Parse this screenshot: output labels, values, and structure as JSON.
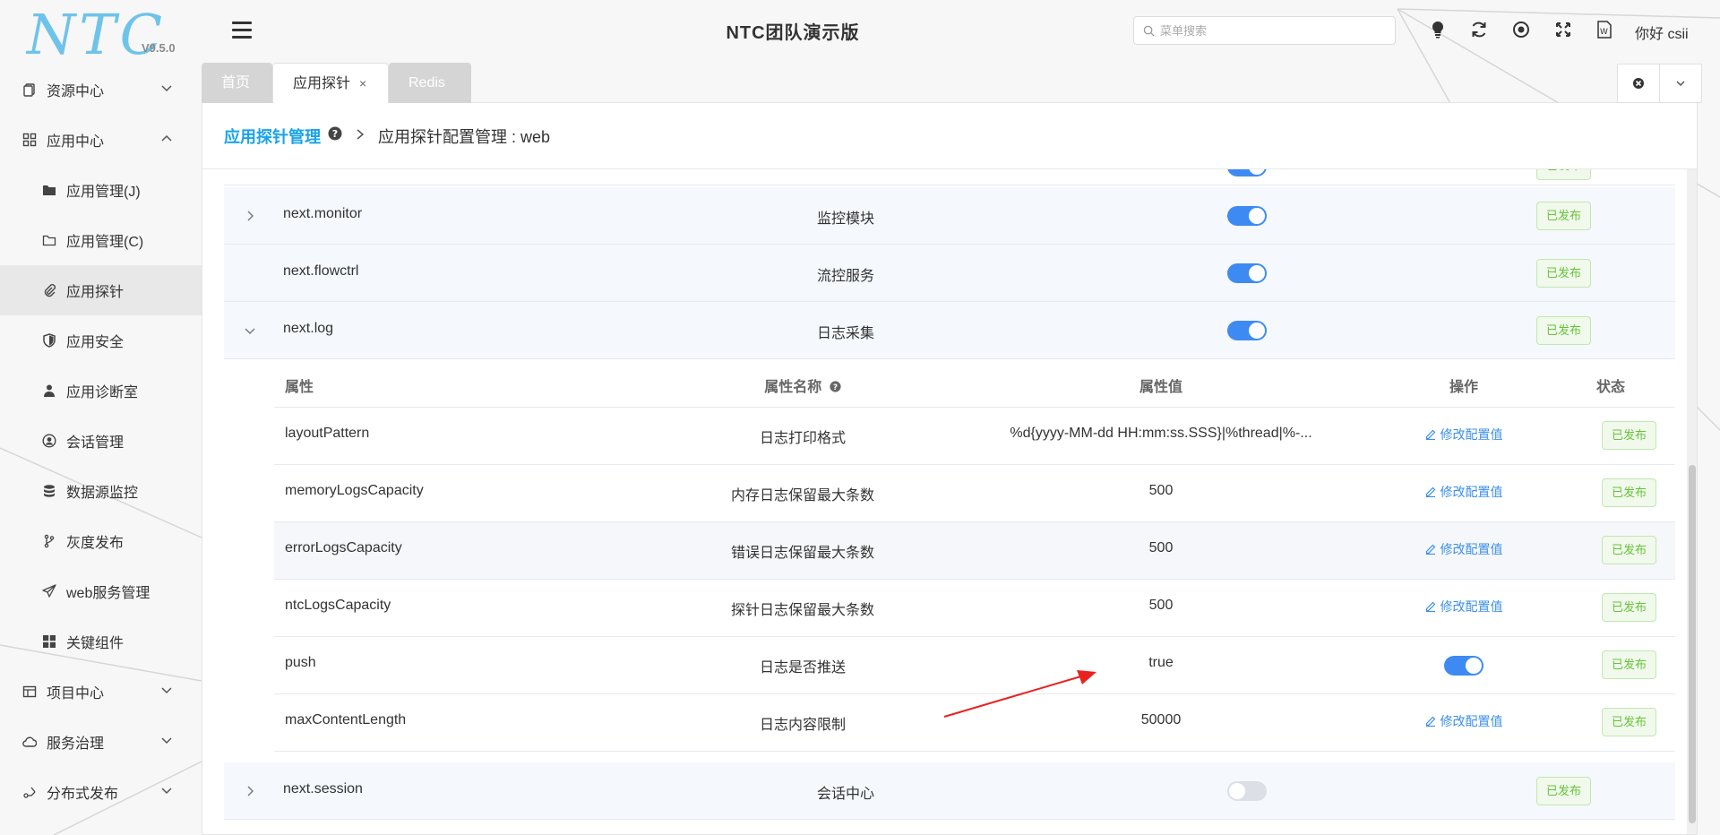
{
  "logo": {
    "brand": "NTC",
    "version": "V9.5.0"
  },
  "sidebar": {
    "items": [
      {
        "label": "资源中心",
        "icon": "file-copy-icon",
        "type": "group",
        "expanded": false
      },
      {
        "label": "应用中心",
        "icon": "grid-icon",
        "type": "group",
        "expanded": true
      },
      {
        "label": "应用管理(J)",
        "icon": "folder-icon",
        "type": "sub"
      },
      {
        "label": "应用管理(C)",
        "icon": "folder-outline-icon",
        "type": "sub"
      },
      {
        "label": "应用探针",
        "icon": "paperclip-icon",
        "type": "sub",
        "active": true
      },
      {
        "label": "应用安全",
        "icon": "shield-icon",
        "type": "sub"
      },
      {
        "label": "应用诊断室",
        "icon": "doctor-icon",
        "type": "sub"
      },
      {
        "label": "会话管理",
        "icon": "user-circle-icon",
        "type": "sub"
      },
      {
        "label": "数据源监控",
        "icon": "database-icon",
        "type": "sub"
      },
      {
        "label": "灰度发布",
        "icon": "branch-icon",
        "type": "sub"
      },
      {
        "label": "web服务管理",
        "icon": "send-icon",
        "type": "sub"
      },
      {
        "label": "关键组件",
        "icon": "apps-icon",
        "type": "sub"
      },
      {
        "label": "项目中心",
        "icon": "project-icon",
        "type": "group",
        "expanded": false
      },
      {
        "label": "服务治理",
        "icon": "cloud-icon",
        "type": "group",
        "expanded": false
      },
      {
        "label": "分布式发布",
        "icon": "deploy-icon",
        "type": "group",
        "expanded": false
      }
    ]
  },
  "header": {
    "title": "NTC团队演示版",
    "search_placeholder": "菜单搜索",
    "greeting": "你好 csii",
    "icons": [
      "bulb-icon",
      "refresh-icon",
      "record-icon",
      "fullscreen-icon",
      "word-doc-icon"
    ]
  },
  "tabs": [
    {
      "label": "首页",
      "active": false
    },
    {
      "label": "应用探针",
      "active": true,
      "closable": true,
      "close_glyph": "×"
    },
    {
      "label": "Redis",
      "active": false
    }
  ],
  "breadcrumb": {
    "root": "应用探针管理",
    "current": "应用探针配置管理 : web"
  },
  "modules": [
    {
      "name": "next.monitor",
      "desc": "监控模块",
      "enabled": true,
      "status": "已发布",
      "expanded": false
    },
    {
      "name": "next.flowctrl",
      "desc": "流控服务",
      "enabled": true,
      "status": "已发布",
      "expanded": null
    },
    {
      "name": "next.log",
      "desc": "日志采集",
      "enabled": true,
      "status": "已发布",
      "expanded": true
    },
    {
      "name": "next.session",
      "desc": "会话中心",
      "enabled": false,
      "status": "已发布",
      "expanded": false
    }
  ],
  "subtable": {
    "headers": {
      "prop": "属性",
      "name": "属性名称",
      "value": "属性值",
      "op": "操作",
      "status": "状态"
    },
    "rows": [
      {
        "prop": "layoutPattern",
        "name": "日志打印格式",
        "value": "%d{yyyy-MM-dd HH:mm:ss.SSS}|%thread|%-...",
        "op": "修改配置值",
        "status": "已发布"
      },
      {
        "prop": "memoryLogsCapacity",
        "name": "内存日志保留最大条数",
        "value": "500",
        "op": "修改配置值",
        "status": "已发布"
      },
      {
        "prop": "errorLogsCapacity",
        "name": "错误日志保留最大条数",
        "value": "500",
        "op": "修改配置值",
        "status": "已发布"
      },
      {
        "prop": "ntcLogsCapacity",
        "name": "探针日志保留最大条数",
        "value": "500",
        "op": "修改配置值",
        "status": "已发布"
      },
      {
        "prop": "push",
        "name": "日志是否推送",
        "value": "true",
        "op_toggle": true,
        "status": "已发布"
      },
      {
        "prop": "maxContentLength",
        "name": "日志内容限制",
        "value": "50000",
        "op": "修改配置值",
        "status": "已发布"
      }
    ]
  },
  "colors": {
    "accent": "#1aa3e8",
    "toggle_on": "#3d8bf2",
    "published": "#67c23a",
    "annotation": "#e8231f"
  }
}
